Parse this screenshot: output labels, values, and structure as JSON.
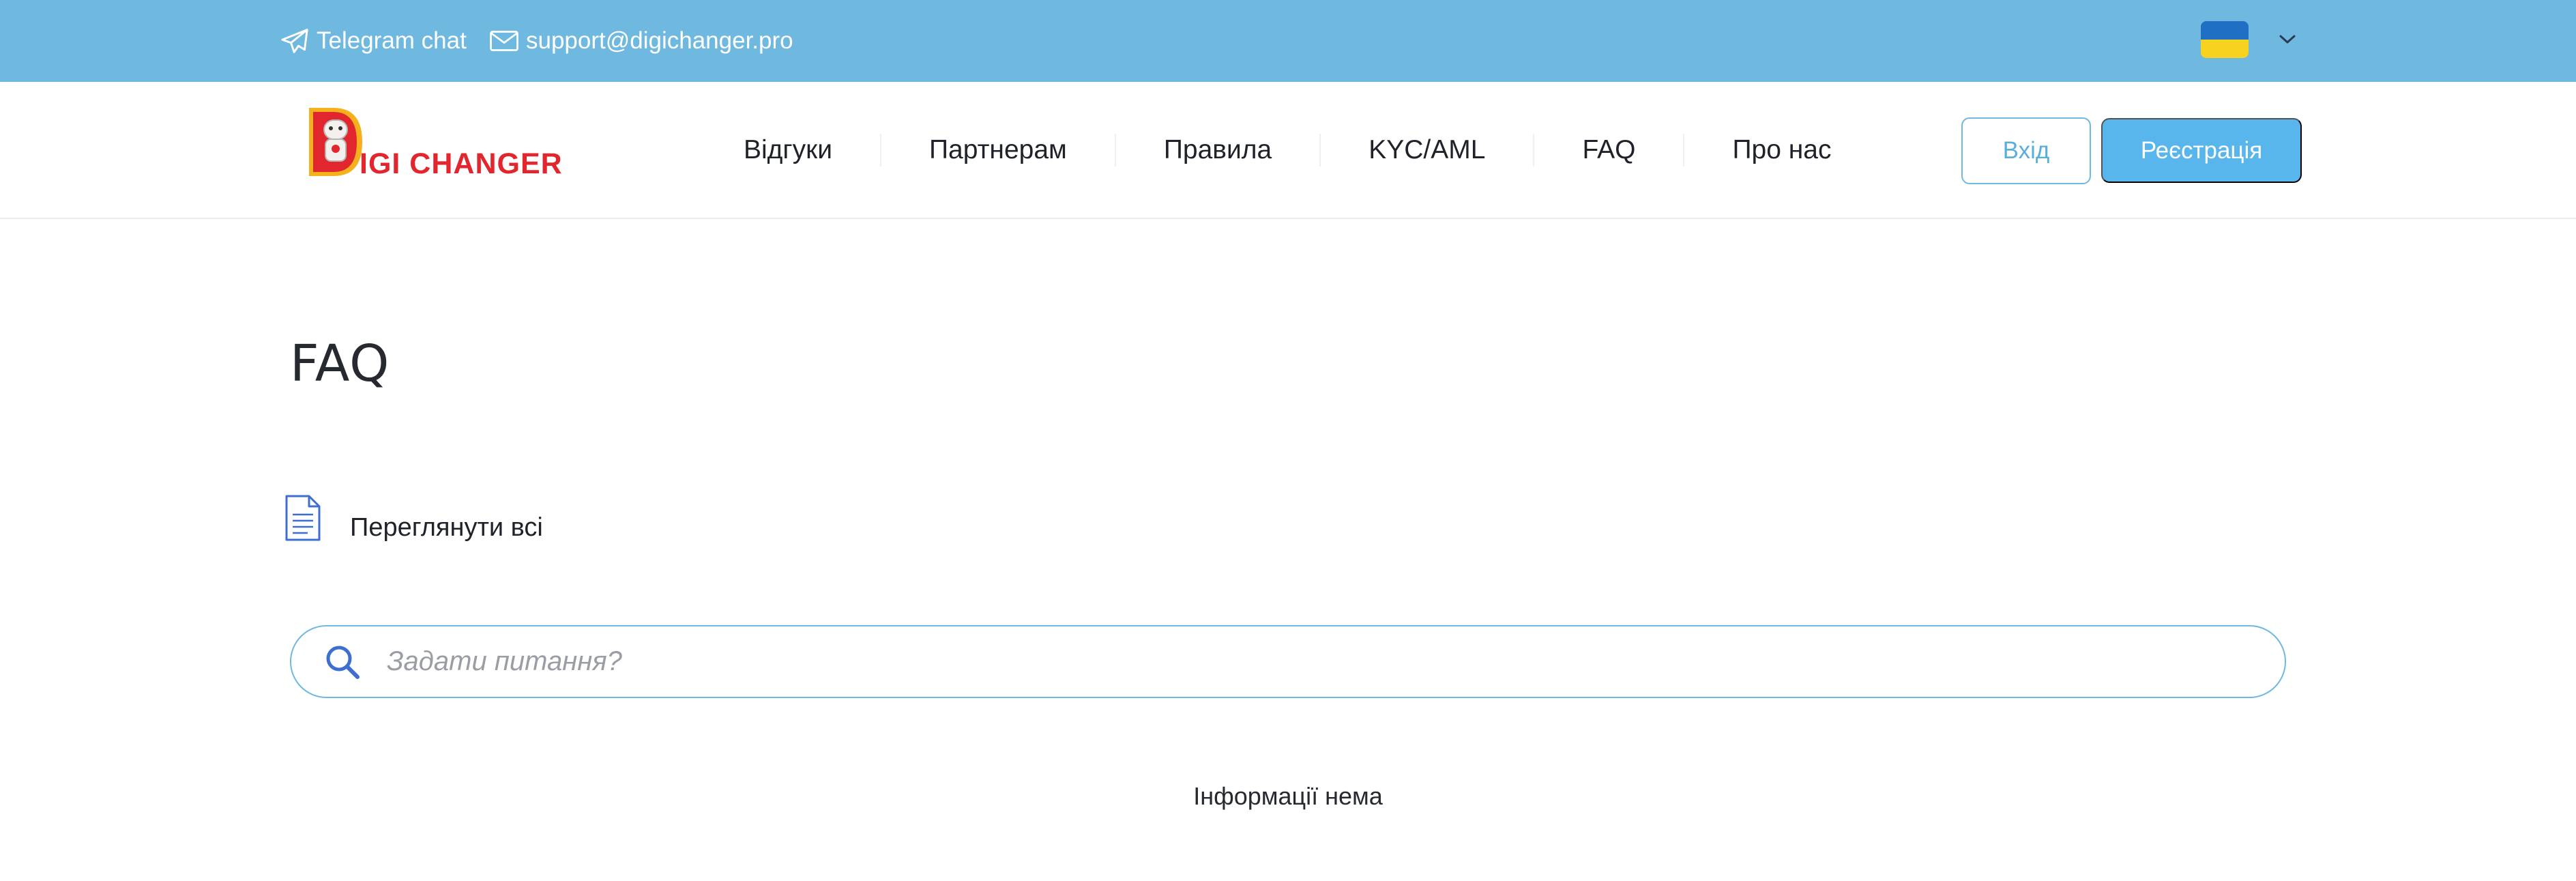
{
  "topbar": {
    "telegram_label": "Telegram chat",
    "email_label": "support@digichanger.pro",
    "language_flag": "ukraine-flag",
    "flag_colors": [
      "#1f6fc5",
      "#f7d21e"
    ],
    "background_color": "#6fb8e0"
  },
  "header": {
    "logo_text": "IGI CHANGER",
    "logo_colors": {
      "red": "#e2262d",
      "yellow": "#f4b11b"
    },
    "nav": [
      {
        "label": "Відгуки"
      },
      {
        "label": "Партнерам"
      },
      {
        "label": "Правила"
      },
      {
        "label": "KYC/AML"
      },
      {
        "label": "FAQ"
      },
      {
        "label": "Про нас"
      }
    ],
    "login_label": "Вхід",
    "register_label": "Реєстрація",
    "accent_color": "#59b6ec"
  },
  "main": {
    "title": "FAQ",
    "view_all_label": "Переглянути всі",
    "search": {
      "placeholder": "Задати питання?",
      "value": ""
    },
    "empty_message": "Інформації нема"
  }
}
